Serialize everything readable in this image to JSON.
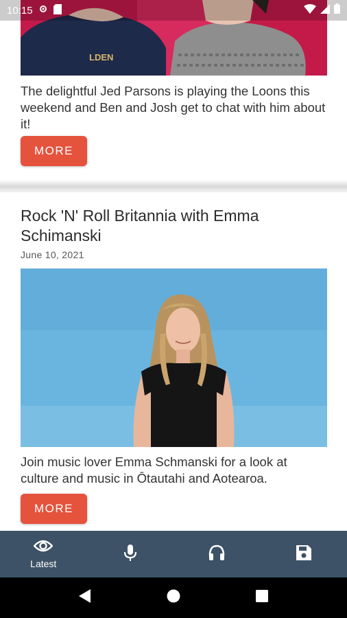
{
  "status_bar": {
    "time": "10:15",
    "icons": [
      "settings-icon",
      "sd-card-icon",
      "wifi-icon",
      "signal-icon",
      "battery-icon"
    ]
  },
  "articles": [
    {
      "title": "",
      "date": "",
      "excerpt": "The delightful Jed Parsons is playing the Loons this weekend and Ben and Josh get to chat with him about it!",
      "more_label": "MORE",
      "image": "two-men-pink-background"
    },
    {
      "title": "Rock 'N' Roll Britannia with Emma Schimanski",
      "date": "June 10, 2021",
      "excerpt": "Join music lover Emma Schmanski for a look at culture and music in Ōtautahi and Aotearoa.",
      "more_label": "MORE",
      "image": "woman-blue-wall"
    }
  ],
  "bottom_nav": {
    "items": [
      {
        "label": "Latest",
        "icon": "eye-icon",
        "active": true
      },
      {
        "label": "",
        "icon": "microphone-icon",
        "active": false
      },
      {
        "label": "",
        "icon": "headphones-icon",
        "active": false
      },
      {
        "label": "",
        "icon": "save-icon",
        "active": false
      }
    ]
  },
  "system_nav": {
    "buttons": [
      "back-icon",
      "home-icon",
      "recents-icon"
    ]
  },
  "colors": {
    "accent": "#e5533d",
    "nav_background": "#3d5266",
    "text": "#333333"
  }
}
